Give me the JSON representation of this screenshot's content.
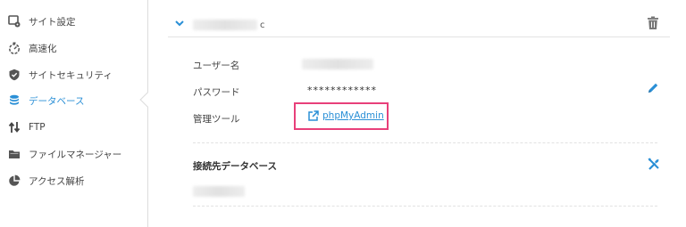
{
  "sidebar": {
    "items": [
      {
        "label": "サイト設定",
        "icon": "site-settings-icon"
      },
      {
        "label": "高速化",
        "icon": "speed-icon"
      },
      {
        "label": "サイトセキュリティ",
        "icon": "shield-icon"
      },
      {
        "label": "データベース",
        "icon": "database-icon",
        "active": true
      },
      {
        "label": "FTP",
        "icon": "transfer-icon"
      },
      {
        "label": "ファイルマネージャー",
        "icon": "folder-icon"
      },
      {
        "label": "アクセス解析",
        "icon": "pie-chart-icon"
      }
    ]
  },
  "database": {
    "name_suffix": "c",
    "user_label": "ユーザー名",
    "password_label": "パスワード",
    "password_value": "************",
    "tool_label": "管理ツール",
    "tool_link": "phpMyAdmin",
    "connected_section_title": "接続先データベース"
  },
  "colors": {
    "accent": "#2a8fd6",
    "highlight": "#e8407a",
    "text": "#444444"
  }
}
